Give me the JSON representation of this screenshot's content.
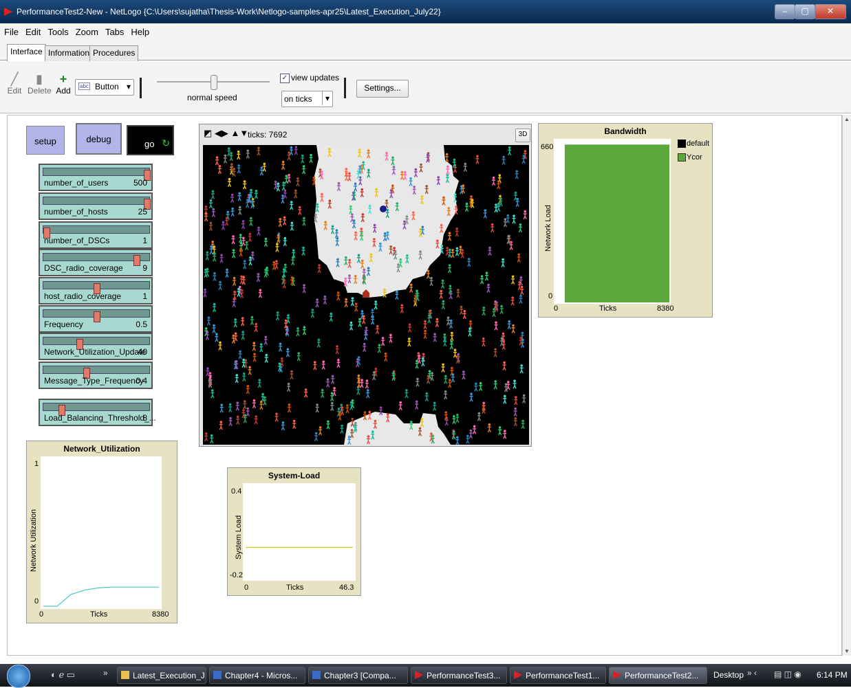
{
  "window": {
    "title": "PerformanceTest2-New - NetLogo {C:\\Users\\sujatha\\Thesis-Work\\Netlogo-samples-apr25\\Latest_Execution_July22}"
  },
  "menu": [
    "File",
    "Edit",
    "Tools",
    "Zoom",
    "Tabs",
    "Help"
  ],
  "tabs": [
    "Interface",
    "Information",
    "Procedures"
  ],
  "toolbar": {
    "edit": "Edit",
    "delete": "Delete",
    "add": "Add",
    "widget_type": "Button",
    "widget_prefix": "abc",
    "speed_label": "normal speed",
    "view_updates": "view updates",
    "update_mode": "on ticks",
    "settings": "Settings..."
  },
  "buttons": {
    "setup": "setup",
    "debug": "debug",
    "go": "go"
  },
  "sliders": [
    {
      "label": "number_of_users",
      "value": "500",
      "level": 1.0
    },
    {
      "label": "number_of_hosts",
      "value": "25",
      "level": 1.0
    },
    {
      "label": "number_of_DSCs",
      "value": "1",
      "level": 0.0
    },
    {
      "label": "DSC_radio_coverage",
      "value": "9",
      "level": 0.9
    },
    {
      "label": "host_radio_coverage",
      "value": "1",
      "level": 0.5
    },
    {
      "label": "Frequency",
      "value": "0.5",
      "level": 0.5
    },
    {
      "label": "Network_Utilization_Update",
      "value": "40",
      "level": 0.33
    },
    {
      "label": "Message_Type_Frequency",
      "value": "0.4",
      "level": 0.4
    },
    {
      "label": "Load_Balancing_Threshold_...",
      "value": "8",
      "level": 0.15
    }
  ],
  "view": {
    "ticks_label": "ticks: 7692",
    "three_d": "3D"
  },
  "chart_data": [
    {
      "type": "area",
      "title": "Bandwidth",
      "xlabel": "Ticks",
      "ylabel": "Network Load",
      "x_min_label": "0",
      "x_max_label": "8380",
      "y_min_label": "0",
      "y_max_label": "660",
      "xlim": [
        0,
        8380
      ],
      "ylim": [
        0,
        660
      ],
      "legend": [
        "default",
        "Ycor"
      ],
      "series": [
        {
          "name": "Ycor",
          "color": "#5aa83c",
          "x": [
            0,
            700,
            700,
            8380
          ],
          "y": [
            0,
            0,
            642,
            642
          ]
        }
      ]
    },
    {
      "type": "line",
      "title": "Network_Utilization",
      "xlabel": "Ticks",
      "ylabel": "Network Utilization",
      "x_min_label": "0",
      "x_max_label": "8380",
      "y_min_label": "0",
      "y_max_label": "1",
      "xlim": [
        0,
        8380
      ],
      "ylim": [
        0,
        1
      ],
      "series": [
        {
          "color": "#4cc8c8",
          "x": [
            0,
            1000,
            2000,
            3000,
            4000,
            5000,
            8380
          ],
          "y": [
            0,
            0,
            0.08,
            0.11,
            0.125,
            0.13,
            0.13
          ]
        }
      ]
    },
    {
      "type": "line",
      "title": "System-Load",
      "xlabel": "Ticks",
      "ylabel": "System Load",
      "x_min_label": "0",
      "x_max_label": "46.3",
      "y_min_label": "-0.2",
      "y_max_label": "0.4",
      "xlim": [
        0,
        46.3
      ],
      "ylim": [
        -0.2,
        0.4
      ],
      "series": [
        {
          "color": "#c8c800",
          "x": [
            0,
            46.3
          ],
          "y": [
            0,
            0
          ]
        }
      ]
    }
  ],
  "taskbar": {
    "tasks": [
      "Latest_Execution_J...",
      "Chapter4 - Micros...",
      "Chapter3 [Compa...",
      "PerformanceTest3...",
      "PerformanceTest1...",
      "PerformanceTest2..."
    ],
    "desktop": "Desktop",
    "clock": "6:14 PM"
  },
  "colors": {
    "slider_bg": "#a8d9d0",
    "button_bg": "#b0b4e8",
    "plot_bg": "#e6e2c2"
  }
}
